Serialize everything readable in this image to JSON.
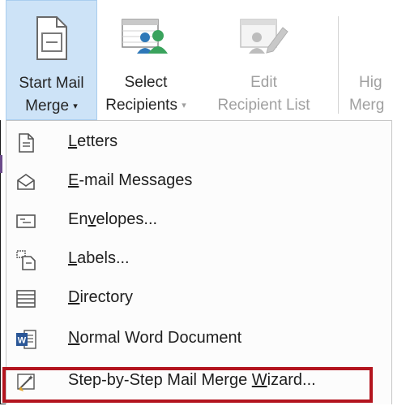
{
  "ribbon": {
    "start_mail_merge": {
      "line1": "Start Mail",
      "line2": "Merge"
    },
    "select_recipients": {
      "line1": "Select",
      "line2": "Recipients"
    },
    "edit_recipient_list": {
      "line1": "Edit",
      "line2": "Recipient List"
    },
    "highlight_merge": {
      "line1": "Hig",
      "line2": "Merg"
    },
    "dropdown_caret": "▾"
  },
  "menu": {
    "letters": {
      "u": "L",
      "rest": "etters"
    },
    "email": {
      "u": "E",
      "rest": "-mail Messages"
    },
    "envelopes": {
      "pre": "En",
      "u": "v",
      "rest": "elopes..."
    },
    "labels": {
      "u": "L",
      "rest": "abels..."
    },
    "directory": {
      "u": "D",
      "rest": "irectory"
    },
    "normal": {
      "u": "N",
      "rest": "ormal Word Document"
    },
    "wizard": {
      "pre": "Step-by-Step Mail Merge ",
      "u": "W",
      "rest": "izard..."
    }
  },
  "icons": {
    "word_badge": "W"
  },
  "colors": {
    "selected_button_bg": "#cde3f7",
    "highlight_border": "#b3141e"
  }
}
